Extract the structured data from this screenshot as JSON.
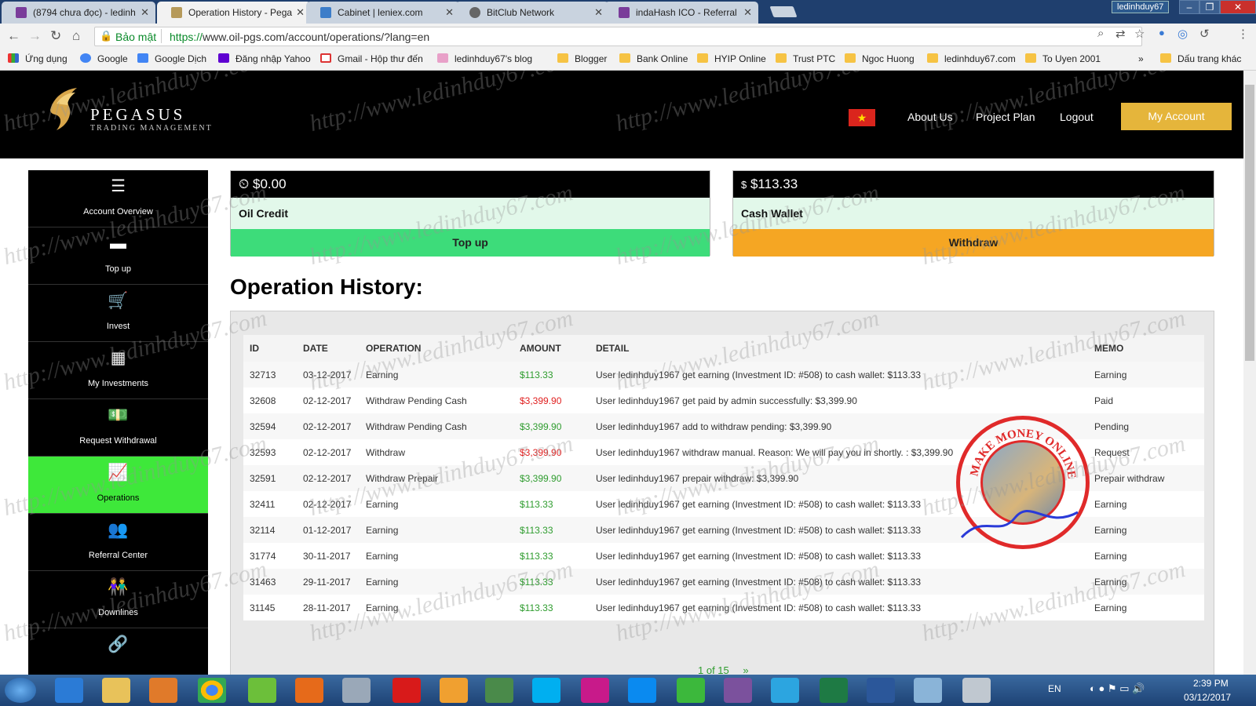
{
  "browser": {
    "tabs": [
      {
        "title": "(8794 chưa đọc) - ledinh",
        "color": "#7a3c9a",
        "active": false
      },
      {
        "title": "Operation History - Pega",
        "color": "#b69a5a",
        "active": true
      },
      {
        "title": "Cabinet | leniex.com",
        "color": "#3c7dc9",
        "active": false
      },
      {
        "title": "BitClub Network",
        "color": "#666666",
        "active": false
      },
      {
        "title": "indaHash ICO - Referral",
        "color": "#7a3c9a",
        "active": false
      }
    ],
    "user": "ledinhduy67",
    "security_label": "Bảo mật",
    "url_scheme": "https://",
    "url_rest": "www.oil-pgs.com/account/operations/?lang=en",
    "bookmarks": [
      {
        "label": "Ứng dụng"
      },
      {
        "label": "Google"
      },
      {
        "label": "Google Dịch"
      },
      {
        "label": "Đăng nhập Yahoo"
      },
      {
        "label": "Gmail - Hộp thư đến"
      },
      {
        "label": "ledinhduy67's blog"
      },
      {
        "label": "Blogger"
      },
      {
        "label": "Bank Online"
      },
      {
        "label": "HYIP Online"
      },
      {
        "label": "Trust PTC"
      },
      {
        "label": "Ngoc Huong"
      },
      {
        "label": "ledinhduy67.com"
      },
      {
        "label": "To Uyen 2001"
      }
    ],
    "bookmarks_overflow": "»",
    "other_bookmarks": "Dấu trang khác"
  },
  "site": {
    "brand": "PEGASUS",
    "brand_sub": "TRADING MANAGEMENT",
    "nav": {
      "about": "About Us",
      "plan": "Project Plan",
      "logout": "Logout",
      "account": "My Account"
    }
  },
  "sidebar": {
    "items": [
      {
        "label": "Account Overview",
        "icon": "menu-icon"
      },
      {
        "label": "Top up",
        "icon": "card-icon"
      },
      {
        "label": "Invest",
        "icon": "cart-icon"
      },
      {
        "label": "My Investments",
        "icon": "grid-icon"
      },
      {
        "label": "Request Withdrawal",
        "icon": "money-icon"
      },
      {
        "label": "Operations",
        "icon": "chart-icon"
      },
      {
        "label": "Referral Center",
        "icon": "users-icon"
      },
      {
        "label": "Downlines",
        "icon": "people-icon"
      },
      {
        "label": "",
        "icon": "link-icon"
      }
    ]
  },
  "wallets": {
    "oil": {
      "amount": "$0.00",
      "label": "Oil Credit",
      "button": "Top up"
    },
    "cash": {
      "amount": "$113.33",
      "label": "Cash Wallet",
      "button": "Withdraw"
    }
  },
  "operations": {
    "title": "Operation History:",
    "columns": [
      "ID",
      "DATE",
      "OPERATION",
      "AMOUNT",
      "DETAIL",
      "MEMO"
    ],
    "rows": [
      {
        "id": "32713",
        "date": "03-12-2017",
        "operation": "Earning",
        "amount": "$113.33",
        "neg": false,
        "detail": "User ledinhduy1967 get earning (Investment ID: #508) to cash wallet: $113.33",
        "memo": "Earning"
      },
      {
        "id": "32608",
        "date": "02-12-2017",
        "operation": "Withdraw Pending Cash",
        "amount": "$3,399.90",
        "neg": true,
        "detail": "User ledinhduy1967 get paid by admin successfully: $3,399.90",
        "memo": "Paid"
      },
      {
        "id": "32594",
        "date": "02-12-2017",
        "operation": "Withdraw Pending Cash",
        "amount": "$3,399.90",
        "neg": false,
        "detail": "User ledinhduy1967 add to withdraw pending: $3,399.90",
        "memo": "Pending"
      },
      {
        "id": "32593",
        "date": "02-12-2017",
        "operation": "Withdraw",
        "amount": "$3,399.90",
        "neg": true,
        "detail": "User ledinhduy1967 withdraw manual. Reason: We will pay you in shortly. : $3,399.90",
        "memo": "Request"
      },
      {
        "id": "32591",
        "date": "02-12-2017",
        "operation": "Withdraw Prepair",
        "amount": "$3,399.90",
        "neg": false,
        "detail": "User ledinhduy1967 prepair withdraw: $3,399.90",
        "memo": "Prepair withdraw"
      },
      {
        "id": "32411",
        "date": "02-12-2017",
        "operation": "Earning",
        "amount": "$113.33",
        "neg": false,
        "detail": "User ledinhduy1967 get earning (Investment ID: #508) to cash wallet: $113.33",
        "memo": "Earning"
      },
      {
        "id": "32114",
        "date": "01-12-2017",
        "operation": "Earning",
        "amount": "$113.33",
        "neg": false,
        "detail": "User ledinhduy1967 get earning (Investment ID: #508) to cash wallet: $113.33",
        "memo": "Earning"
      },
      {
        "id": "31774",
        "date": "30-11-2017",
        "operation": "Earning",
        "amount": "$113.33",
        "neg": false,
        "detail": "User ledinhduy1967 get earning (Investment ID: #508) to cash wallet: $113.33",
        "memo": "Earning"
      },
      {
        "id": "31463",
        "date": "29-11-2017",
        "operation": "Earning",
        "amount": "$113.33",
        "neg": false,
        "detail": "User ledinhduy1967 get earning (Investment ID: #508) to cash wallet: $113.33",
        "memo": "Earning"
      },
      {
        "id": "31145",
        "date": "28-11-2017",
        "operation": "Earning",
        "amount": "$113.33",
        "neg": false,
        "detail": "User ledinhduy1967 get earning (Investment ID: #508) to cash wallet: $113.33",
        "memo": "Earning"
      }
    ],
    "pager": "1 of 15",
    "next": "»"
  },
  "overlay": {
    "watermark": "http://www.ledinhduy67.com",
    "stamp_text": "MAKE MONEY ONLINE"
  },
  "taskbar": {
    "lang": "EN",
    "time": "2:39 PM",
    "date": "03/12/2017"
  },
  "colors": {
    "topup": "#3ddc7a",
    "withdraw": "#f5a623",
    "active_nav": "#3ee83a",
    "positive": "#2e9c2e",
    "negative": "#e02020",
    "gold": "#e5b53b"
  }
}
